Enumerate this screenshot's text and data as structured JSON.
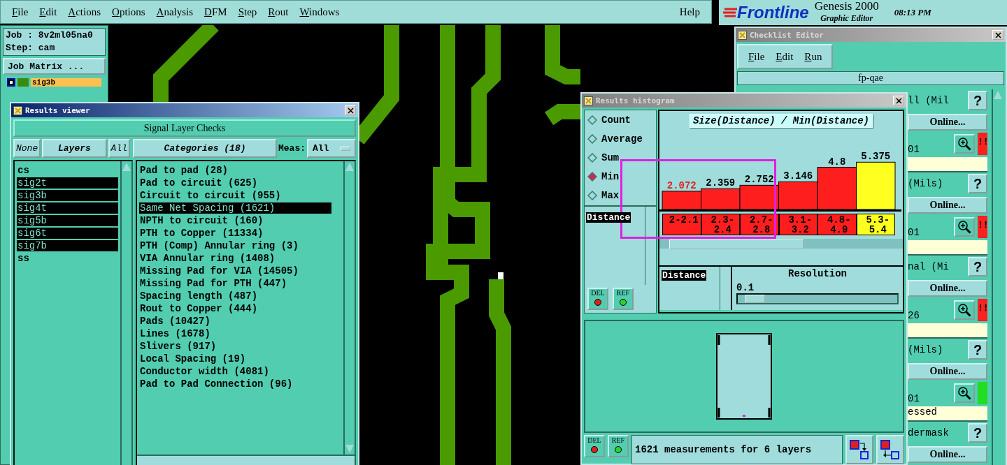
{
  "menu_bar": {
    "items": [
      "File",
      "Edit",
      "Actions",
      "Options",
      "Analysis",
      "DFM",
      "Step",
      "Rout",
      "Windows"
    ],
    "help": "Help"
  },
  "brand": {
    "logo": "Frontline",
    "product": "Genesis 2000",
    "subtitle": "Graphic Editor",
    "time": "08:13 PM"
  },
  "job_panel": {
    "job": "Job : 8v2ml05na0",
    "step": "Step: cam",
    "matrix_button": "Job Matrix ...",
    "layers": [
      {
        "name": "sig3b",
        "selected": true
      }
    ]
  },
  "results_viewer": {
    "title": "Results viewer",
    "heading": "Signal Layer Checks",
    "none_button": "None",
    "layers_label": "Layers",
    "all_button": "All",
    "categories_button": "Categories (18)",
    "meas_label": "Meas:",
    "meas_value": "All",
    "layers": [
      {
        "name": "cs",
        "selected": false
      },
      {
        "name": "sig2t",
        "selected": true
      },
      {
        "name": "sig3b",
        "selected": true
      },
      {
        "name": "sig4t",
        "selected": true
      },
      {
        "name": "sig5b",
        "selected": true
      },
      {
        "name": "sig6t",
        "selected": true
      },
      {
        "name": "sig7b",
        "selected": true
      },
      {
        "name": "ss",
        "selected": false
      }
    ],
    "categories": [
      {
        "label": "Pad to pad (28)",
        "selected": false
      },
      {
        "label": "Pad to circuit (625)",
        "selected": false
      },
      {
        "label": "Circuit to circuit (955)",
        "selected": false
      },
      {
        "label": "Same Net Spacing (1621)",
        "selected": true
      },
      {
        "label": "NPTH to circuit (160)",
        "selected": false
      },
      {
        "label": "PTH to Copper (11334)",
        "selected": false
      },
      {
        "label": "PTH (Comp) Annular ring (3)",
        "selected": false
      },
      {
        "label": "VIA Annular ring (1408)",
        "selected": false
      },
      {
        "label": "Missing Pad for VIA (14505)",
        "selected": false
      },
      {
        "label": "Missing Pad for PTH (447)",
        "selected": false
      },
      {
        "label": "Spacing length (487)",
        "selected": false
      },
      {
        "label": "Rout to Copper (444)",
        "selected": false
      },
      {
        "label": "Pads (10427)",
        "selected": false
      },
      {
        "label": "Lines (1678)",
        "selected": false
      },
      {
        "label": "Slivers (917)",
        "selected": false
      },
      {
        "label": "Local Spacing (19)",
        "selected": false
      },
      {
        "label": "Conductor width (4081)",
        "selected": false
      },
      {
        "label": "Pad to Pad Connection (96)",
        "selected": false
      }
    ]
  },
  "histogram": {
    "title": "Results histogram",
    "modes": [
      {
        "label": "Count",
        "selected": false
      },
      {
        "label": "Average",
        "selected": false
      },
      {
        "label": "Sum",
        "selected": false
      },
      {
        "label": "Min",
        "selected": true
      },
      {
        "label": "Max",
        "selected": false
      }
    ],
    "fields": [
      {
        "label": "Distance",
        "selected": true
      }
    ],
    "top_buttons": [
      "DEL",
      "REF"
    ],
    "chart_data": {
      "type": "bar",
      "title": "Size(Distance) / Min(Distance)",
      "categories": [
        "2-2.1",
        "2.3-2.4",
        "2.7-2.8",
        "3.1-3.2",
        "4.8-4.9",
        "5.3-5.4"
      ],
      "values": [
        2.072,
        2.359,
        2.752,
        3.146,
        4.8,
        5.375
      ],
      "data_labels": true
    },
    "bins": [
      {
        "selected": false
      },
      {
        "selected": false
      },
      {
        "selected": false
      },
      {
        "selected": false
      },
      {
        "selected": false
      },
      {
        "selected": true
      }
    ],
    "resolution": {
      "field": "Distance",
      "field_selected": true,
      "label": "Resolution",
      "value": "0.1",
      "level": 0.05
    },
    "bottom_buttons": [
      "DEL",
      "REF"
    ],
    "status": "1621 measurements for 6 layers"
  },
  "checklist": {
    "title": "Checklist Editor",
    "menu": [
      "File",
      "Edit",
      "Run"
    ],
    "name": "fp-qae",
    "checks": [
      {
        "name": "ll (Mil",
        "help": "?",
        "action": "Online...",
        "count": "01",
        "flag": "!!",
        "color": "#ff2020"
      },
      {
        "name": "(Mils)",
        "help": "?",
        "action": "Online...",
        "count": "01",
        "flag": "!!",
        "color": "#ff2020"
      },
      {
        "name": "nal (Mi",
        "help": "?",
        "action": "Online...",
        "count": "26",
        "flag": "!!",
        "color": "#ff2020"
      },
      {
        "name": "(Mils)",
        "help": "?",
        "action": "Online...",
        "count": "01",
        "color": "#22dd22",
        "note": "essed"
      },
      {
        "name": "dermask",
        "help": "?",
        "action": "Online..."
      }
    ]
  }
}
